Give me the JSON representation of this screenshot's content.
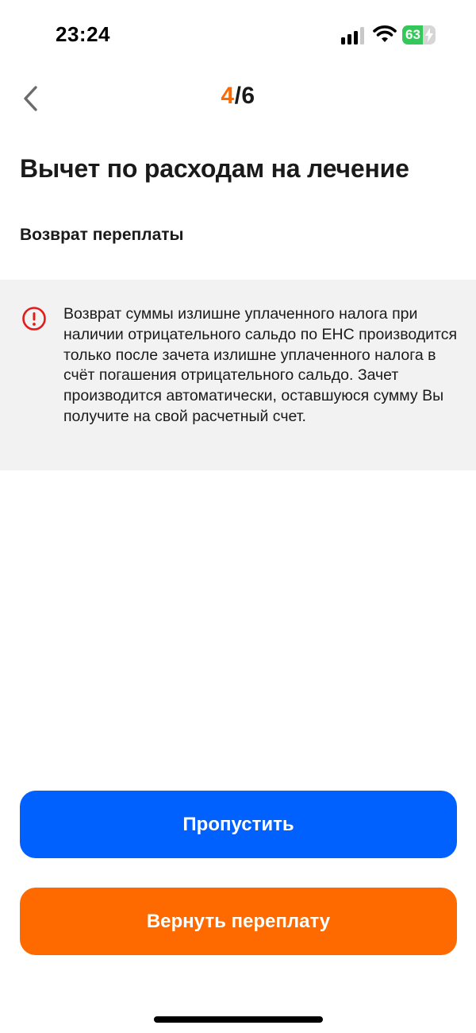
{
  "status_bar": {
    "time": "23:24",
    "battery_level": "63",
    "battery_fraction": 0.63,
    "icons": [
      "cellular-signal-icon",
      "wifi-icon",
      "battery-charging-icon"
    ]
  },
  "header": {
    "back_icon": "chevron-left-icon",
    "step_current": "4",
    "step_separator": "/",
    "step_total": "6"
  },
  "title": "Вычет по расходам на лечение",
  "subtitle": "Возврат переплаты",
  "notice": {
    "icon": "alert-circle-icon",
    "icon_color": "#e21b1b",
    "text": "Возврат суммы излишне уплаченного налога при наличии отрицательного сальдо по ЕНС производится только после зачета излишне уплаченного налога в счёт погашения отрицательного сальдо. Зачет производится автоматически, оставшуюся сумму Вы получите на свой расчетный счет."
  },
  "actions": {
    "skip_label": "Пропустить",
    "refund_label": "Вернуть переплату"
  },
  "colors": {
    "accent_orange": "#ff6a00",
    "primary_blue": "#0061fe",
    "notice_background": "#f2f2f2",
    "battery_green": "#34c759"
  }
}
